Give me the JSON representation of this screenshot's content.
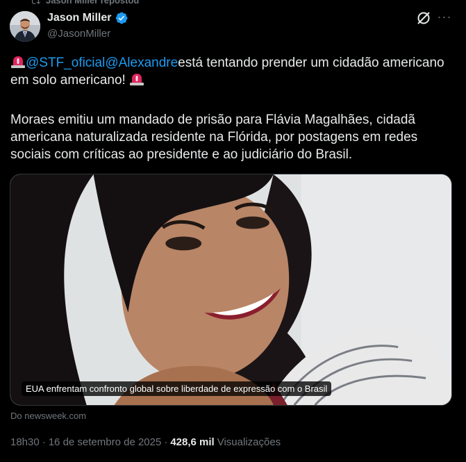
{
  "repost": {
    "text": "Jason Miller repostou"
  },
  "author": {
    "name": "Jason Miller",
    "handle": "@JasonMiller"
  },
  "tweet": {
    "mention1": "@STF_oficial",
    "mention2": "@Alexandre",
    "line1_rest": "está tentando prender um cidadão americano em solo americano! ",
    "paragraph2": "Moraes emitiu um mandado de prisão para Flávia Magalhães, cidadã americana naturalizada residente na Flórida, por postagens em redes sociais com críticas ao presidente e ao judiciário do Brasil."
  },
  "card": {
    "caption": "EUA enfrentam confronto global sobre liberdade de expressão com o Brasil",
    "source": "Do newsweek.com"
  },
  "meta": {
    "time": "18h30",
    "sep1": "·",
    "date": "16 de setembro de 2025",
    "sep2": "·",
    "views_count": "428,6 mil",
    "views_label": "Visualizações"
  },
  "icons": {
    "repost": "repost-icon",
    "verified": "verified-badge-icon",
    "grok": "grok-icon",
    "more": "more-icon",
    "siren": "police-siren-icon"
  },
  "colors": {
    "link": "#1d9bf0",
    "muted": "#71767b",
    "text": "#e7e9ea",
    "background": "#000000"
  }
}
